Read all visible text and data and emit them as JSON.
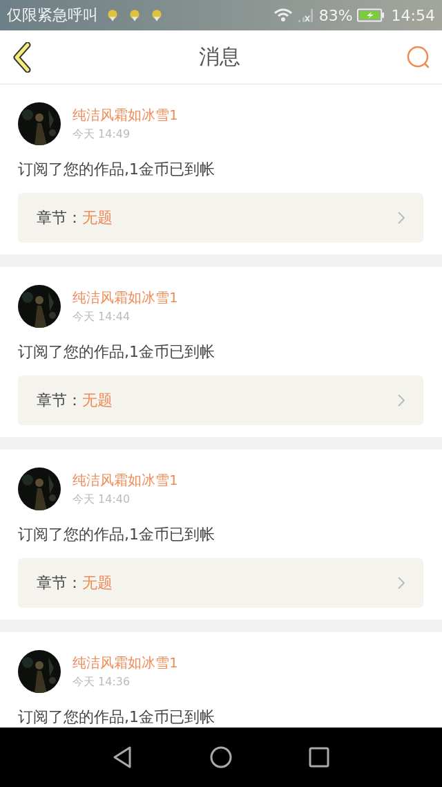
{
  "status_bar": {
    "carrier": "仅限紧急呼叫",
    "battery": "83%",
    "time": "14:54"
  },
  "header": {
    "title": "消息"
  },
  "messages": [
    {
      "user": "纯洁风霜如冰雪1",
      "time": "今天 14:49",
      "text": "订阅了您的作品,1金币已到帐",
      "chapter": {
        "label": "章节：",
        "title": "无题"
      }
    },
    {
      "user": "纯洁风霜如冰雪1",
      "time": "今天 14:44",
      "text": "订阅了您的作品,1金币已到帐",
      "chapter": {
        "label": "章节：",
        "title": "无题"
      }
    },
    {
      "user": "纯洁风霜如冰雪1",
      "time": "今天 14:40",
      "text": "订阅了您的作品,1金币已到帐",
      "chapter": {
        "label": "章节：",
        "title": "无题"
      }
    },
    {
      "user": "纯洁风霜如冰雪1",
      "time": "今天 14:36",
      "text": "订阅了您的作品,1金币已到帐"
    }
  ]
}
